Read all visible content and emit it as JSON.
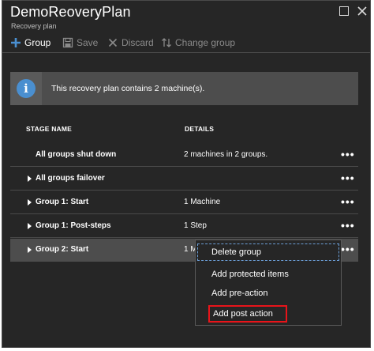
{
  "blade": {
    "title": "DemoReoveryPlan",
    "subtitle": "Recovery plan"
  },
  "toolbar": {
    "group_label": "Group",
    "save_label": "Save",
    "discard_label": "Discard",
    "change_group_label": "Change group"
  },
  "info": {
    "message": "This recovery plan contains 2 machine(s)."
  },
  "table": {
    "headers": {
      "stage": "STAGE NAME",
      "details": "DETAILS"
    },
    "rows": [
      {
        "name": "All groups shut down",
        "details": "2 machines in 2 groups.",
        "expandable": false,
        "more": "•••"
      },
      {
        "name": "All groups failover",
        "details": "",
        "expandable": true,
        "more": "•••"
      },
      {
        "name": "Group 1: Start",
        "details": "1 Machine",
        "expandable": true,
        "more": "•••"
      },
      {
        "name": "Group 1: Post-steps",
        "details": "1 Step",
        "expandable": true,
        "more": "•••"
      },
      {
        "name": "Group 2: Start",
        "details": "1 M",
        "expandable": true,
        "more": "•••",
        "selected": true
      }
    ]
  },
  "context_menu": {
    "items": [
      "Delete group",
      "Add protected items",
      "Add pre-action",
      "Add post action"
    ]
  },
  "colors": {
    "background": "#262626",
    "info_bar": "#4d4d4d",
    "accent_blue": "#4a8fd0",
    "highlight_red": "#e8141a"
  }
}
